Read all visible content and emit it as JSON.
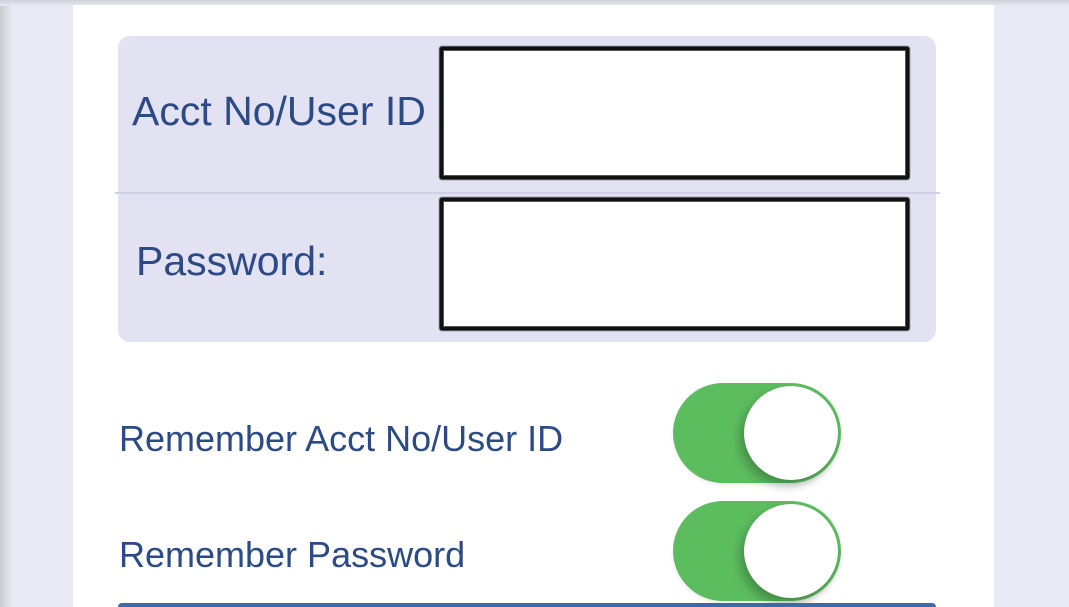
{
  "login_form": {
    "account_label": "Acct No/User ID",
    "account_value": "",
    "password_label": "Password:",
    "password_value": ""
  },
  "settings": {
    "remember_account": {
      "label": "Remember Acct No/User ID",
      "enabled": true
    },
    "remember_password": {
      "label": "Remember Password",
      "enabled": true
    }
  },
  "colors": {
    "accent_green": "#5cbd5f",
    "label_blue": "#2b4a86",
    "card_background": "#e3e2f2"
  }
}
